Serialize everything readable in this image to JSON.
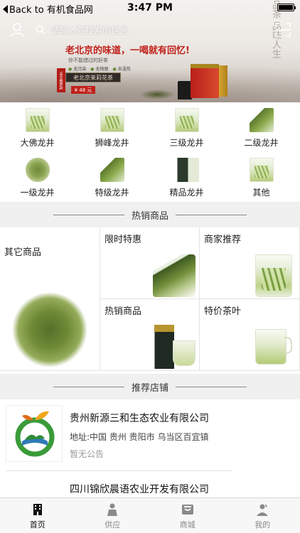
{
  "status_bar": {
    "back_label": "Back to 有机食品网",
    "time": "3:47 PM"
  },
  "search": {
    "placeholder": "请输入要搜索的信息"
  },
  "banner": {
    "tagline": "老北京的味道，一喝就有回忆!",
    "subline": "你不能错过的好茶",
    "badges": [
      "无污染",
      "无残留",
      "去湿热"
    ],
    "product_plaque": "老北京茉莉花茶",
    "price": "¥ 48 元",
    "red_tag": "店主推荐款",
    "calligraphy": "品茶 品味人生"
  },
  "categories": [
    {
      "label": "大佛龙井",
      "icon": "glass"
    },
    {
      "label": "狮峰龙井",
      "icon": "glass"
    },
    {
      "label": "三级龙井",
      "icon": "glass"
    },
    {
      "label": "二级龙井",
      "icon": "spill"
    },
    {
      "label": "一级龙井",
      "icon": "loose"
    },
    {
      "label": "特级龙井",
      "icon": "spill"
    },
    {
      "label": "精品龙井",
      "icon": "tin"
    },
    {
      "label": "其他",
      "icon": "glass"
    }
  ],
  "hot_section": {
    "title": "热销商品",
    "cells": [
      "其它商品",
      "限时特惠",
      "商家推荐",
      "热销商品",
      "特价茶叶"
    ]
  },
  "shop_section": {
    "title": "推荐店铺",
    "shops": [
      {
        "name": "贵州新源三和生态农业有限公司",
        "address": "地址:中国 贵州 贵阳市 乌当区百宜镇",
        "notice": "暂无公告"
      },
      {
        "name": "四川锦欣晨语农业开发有限公司"
      }
    ]
  },
  "tabbar": {
    "tabs": [
      {
        "label": "首页",
        "icon": "building-icon",
        "active": true
      },
      {
        "label": "供应",
        "icon": "person-icon",
        "active": false
      },
      {
        "label": "商城",
        "icon": "store-icon",
        "active": false
      },
      {
        "label": "我的",
        "icon": "profile-icon",
        "active": false
      }
    ]
  },
  "colors": {
    "accent_red": "#c0201a",
    "section_bg": "#f0f0f0",
    "tab_active": "#111111",
    "tab_inactive": "#8a8a8a"
  }
}
